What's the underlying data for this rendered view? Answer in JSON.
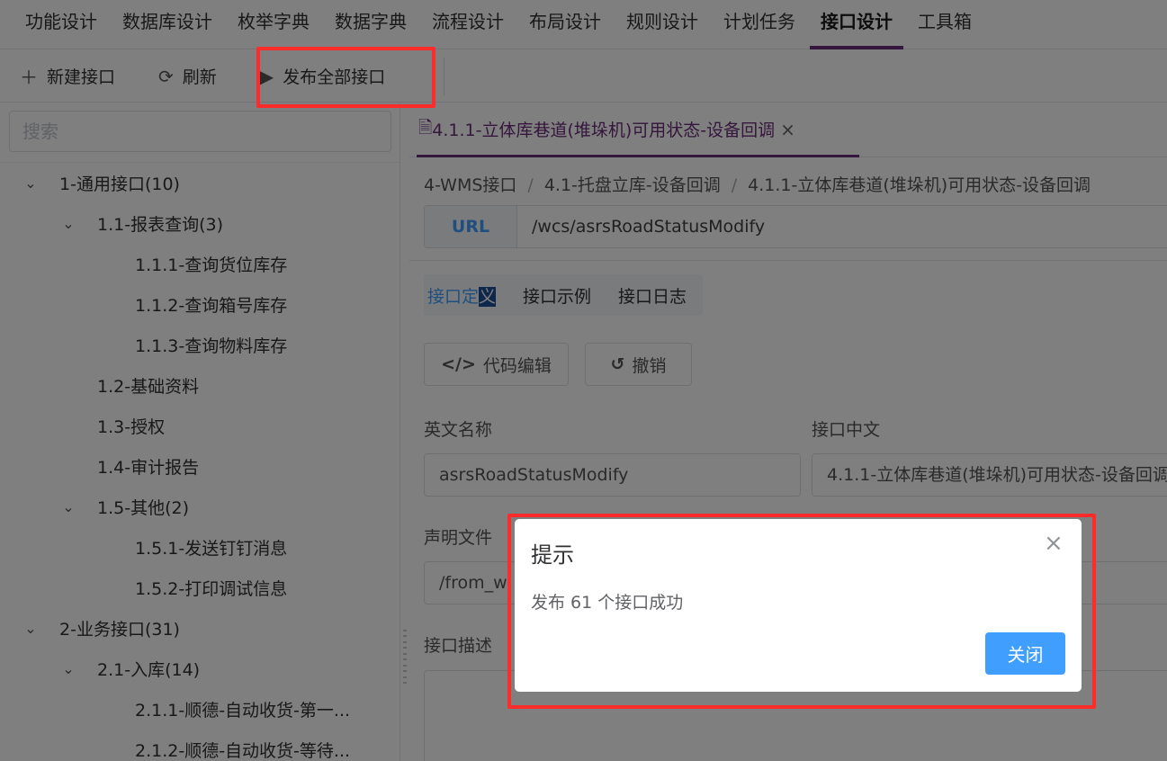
{
  "topnav": {
    "items": [
      "功能设计",
      "数据库设计",
      "枚举字典",
      "数据字典",
      "流程设计",
      "布局设计",
      "规则设计",
      "计划任务",
      "接口设计",
      "工具箱"
    ],
    "active": "接口设计"
  },
  "toolbar": {
    "new_label": "新建接口",
    "refresh_label": "刷新",
    "publish_label": "发布全部接口"
  },
  "sidebar": {
    "search_placeholder": "搜索",
    "tree": [
      {
        "label": "1-通用接口(10)",
        "level": 0,
        "expand": true
      },
      {
        "label": "1.1-报表查询(3)",
        "level": 1,
        "expand": true
      },
      {
        "label": "1.1.1-查询货位库存",
        "level": 2,
        "expand": false
      },
      {
        "label": "1.1.2-查询箱号库存",
        "level": 2,
        "expand": false
      },
      {
        "label": "1.1.3-查询物料库存",
        "level": 2,
        "expand": false
      },
      {
        "label": "1.2-基础资料",
        "level": 1,
        "expand": false
      },
      {
        "label": "1.3-授权",
        "level": 1,
        "expand": false
      },
      {
        "label": "1.4-审计报告",
        "level": 1,
        "expand": false
      },
      {
        "label": "1.5-其他(2)",
        "level": 1,
        "expand": true
      },
      {
        "label": "1.5.1-发送钉钉消息",
        "level": 2,
        "expand": false
      },
      {
        "label": "1.5.2-打印调试信息",
        "level": 2,
        "expand": false
      },
      {
        "label": "2-业务接口(31)",
        "level": 0,
        "expand": true
      },
      {
        "label": "2.1-入库(14)",
        "level": 1,
        "expand": true
      },
      {
        "label": "2.1.1-顺德-自动收货-第一...",
        "level": 2,
        "expand": false
      },
      {
        "label": "2.1.2-顺德-自动收货-等待...",
        "level": 2,
        "expand": false
      }
    ]
  },
  "main": {
    "tab_title": "4.1.1-立体库巷道(堆垛机)可用状态-设备回调",
    "breadcrumb": [
      "4-WMS接口",
      "4.1-托盘立库-设备回调",
      "4.1.1-立体库巷道(堆垛机)可用状态-设备回调"
    ],
    "url_label": "URL",
    "url_value": "/wcs/asrsRoadStatusModify",
    "subtabs": {
      "def_a": "接口定",
      "def_b": "义",
      "example": "接口示例",
      "log": "接口日志"
    },
    "code_edit_label": "代码编辑",
    "undo_label": "撤销",
    "en_name_label": "英文名称",
    "en_name_value": "asrsRoadStatusModify",
    "cn_name_label": "接口中文",
    "cn_name_value": "4.1.1-立体库巷道(堆垛机)可用状态-设备回调",
    "decl_label": "声明文件",
    "decl_value": "/from_w",
    "desc_label": "接口描述"
  },
  "dialog": {
    "title": "提示",
    "message": "发布 61 个接口成功",
    "close_button": "关闭"
  },
  "colors": {
    "accent": "#6b2d7a",
    "primary": "#409eff",
    "highlight": "#ff2a2a"
  }
}
